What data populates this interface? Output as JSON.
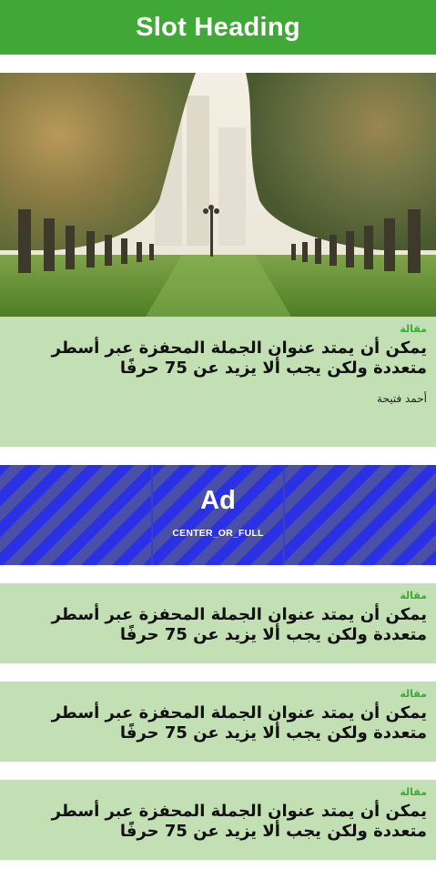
{
  "slot": {
    "heading": "Slot Heading"
  },
  "hero_image": {
    "description_icon": "palm-avenue-photo"
  },
  "articles": [
    {
      "kicker": "مقالة",
      "title": "يمكن أن يمتد عنوان الجملة المحفزة عبر أسطر متعددة ولكن يجب ألا يزيد عن 75 حرفًا",
      "author": "أحمد فتيحة"
    },
    {
      "kicker": "مقالة",
      "title": "يمكن أن يمتد عنوان الجملة المحفزة عبر أسطر متعددة ولكن يجب ألا يزيد عن 75 حرفًا"
    },
    {
      "kicker": "مقالة",
      "title": "يمكن أن يمتد عنوان الجملة المحفزة عبر أسطر متعددة ولكن يجب ألا يزيد عن 75 حرفًا"
    },
    {
      "kicker": "مقالة",
      "title": "يمكن أن يمتد عنوان الجملة المحفزة عبر أسطر متعددة ولكن يجب ألا يزيد عن 75 حرفًا"
    }
  ],
  "ad": {
    "label": "Ad",
    "type": "CENTER_OR_FULL"
  },
  "colors": {
    "brand_green": "#3fa836",
    "card_background": "#c3e0b5",
    "ad_blue": "#2a30e6"
  }
}
